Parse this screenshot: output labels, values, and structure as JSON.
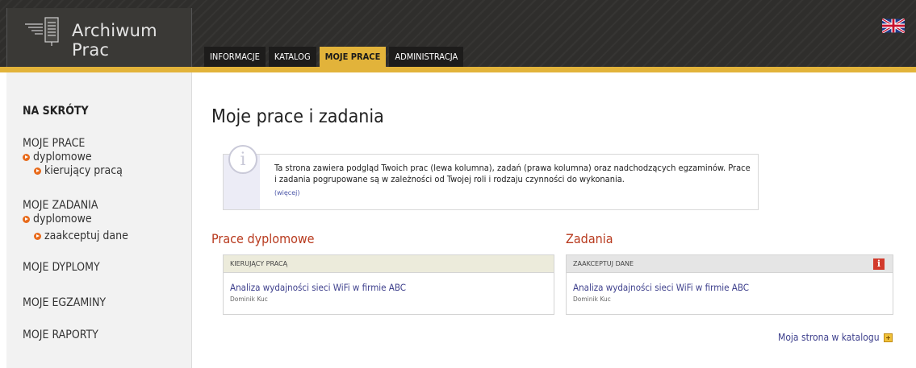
{
  "header": {
    "app_title": "Archiwum Prac",
    "logo_icon": "document-stack-icon",
    "language_icon": "uk-flag-icon"
  },
  "nav": {
    "tabs": [
      {
        "label": "INFORMACJE",
        "active": false
      },
      {
        "label": "KATALOG",
        "active": false
      },
      {
        "label": "MOJE PRACE",
        "active": true
      },
      {
        "label": "ADMINISTRACJA",
        "active": false
      }
    ]
  },
  "sidebar": {
    "heading": "NA SKRÓTY",
    "prace": "MOJE PRACE",
    "prace_dyplomowe": "dyplomowe",
    "prace_kierujacy": "kierujący pracą",
    "zadania": "MOJE ZADANIA",
    "zadania_dyplomowe": "dyplomowe",
    "zadania_zaakceptuj": "zaakceptuj dane",
    "dyplomy": "MOJE DYPLOMY",
    "egzaminy": "MOJE EGZAMINY",
    "raporty": "MOJE RAPORTY"
  },
  "main": {
    "title": "Moje prace i zadania",
    "info_text": "Ta strona zawiera podgląd Twoich prac (lewa kolumna), zadań (prawa kolumna) oraz nadchodzących egzaminów. Prace i zadania pogrupowane są w zależności od Twojej roli i rodzaju czynności do wykonania.",
    "info_more": "(więcej)",
    "left_column_title": "Prace dyplomowe",
    "left_panel_header": "KIERUJĄCY PRACĄ",
    "left_item_title": "Analiza wydajności sieci WiFi w firmie ABC",
    "left_item_author": "Dominik Kuc",
    "right_column_title": "Zadania",
    "right_panel_header": "ZAAKCEPTUJ DANE",
    "right_item_title": "Analiza wydajności sieci WiFi w firmie ABC",
    "right_item_author": "Dominik Kuc",
    "catalog_link": "Moja strona w katalogu"
  },
  "colors": {
    "accent_gold": "#e2b33a",
    "header_dark": "#2f2e2c",
    "column_title_red": "#b83a1e",
    "link_blue": "#3d3f8c",
    "alert_red": "#d23a2b",
    "bullet_orange": "#e86b1c"
  }
}
